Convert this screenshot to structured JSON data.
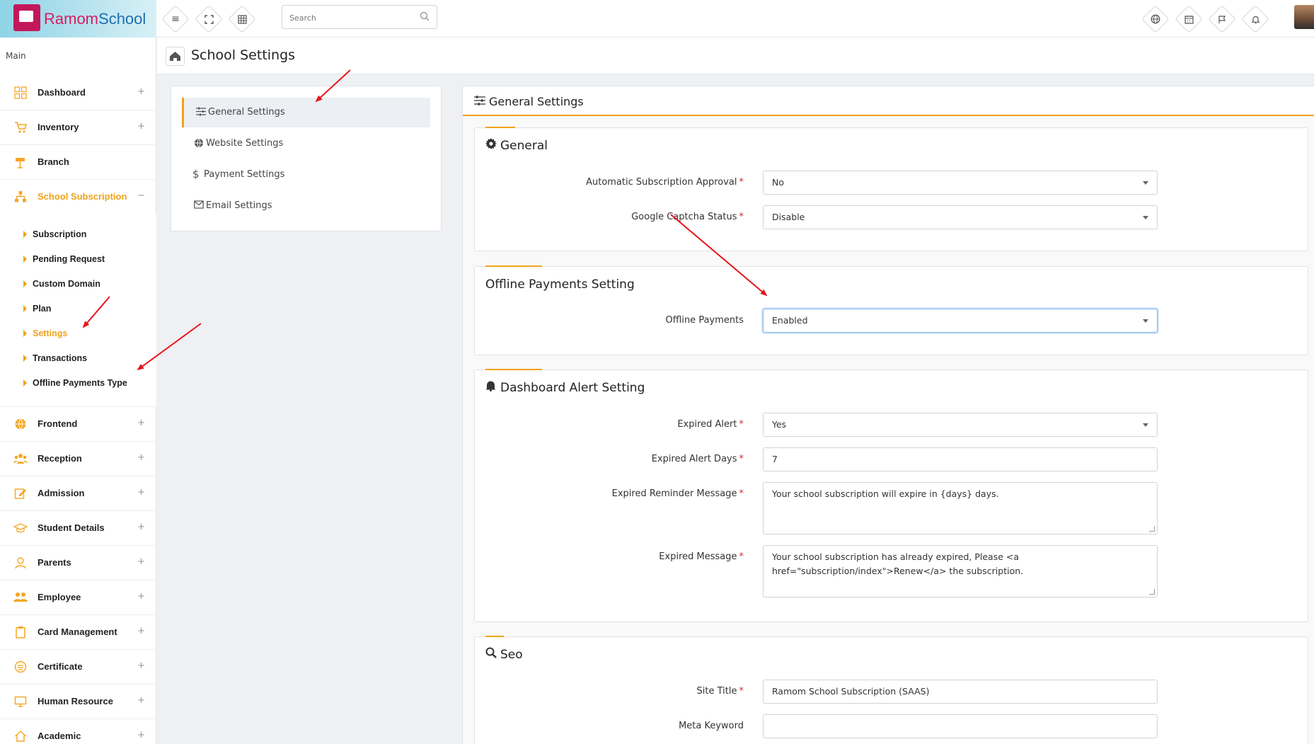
{
  "brand": {
    "part1": "Ramom",
    "part2": "School"
  },
  "topbar": {
    "search_placeholder": "Search",
    "left_tools": [
      "menu-icon",
      "fullscreen-icon",
      "grid-icon"
    ],
    "right_tools": [
      "globe-icon",
      "calendar-icon",
      "flag-icon",
      "bell-icon"
    ]
  },
  "sidebar": {
    "title": "Main",
    "items": [
      {
        "label": "Dashboard",
        "icon": "dashboard-icon",
        "toggle": "+"
      },
      {
        "label": "Inventory",
        "icon": "cart-icon",
        "toggle": "+"
      },
      {
        "label": "Branch",
        "icon": "signpost-icon",
        "toggle": ""
      },
      {
        "label": "School Subscription",
        "icon": "sitemap-icon",
        "toggle": "−"
      }
    ],
    "subscription_sub": [
      {
        "label": "Subscription"
      },
      {
        "label": "Pending Request"
      },
      {
        "label": "Custom Domain"
      },
      {
        "label": "Plan"
      },
      {
        "label": "Settings"
      },
      {
        "label": "Transactions"
      },
      {
        "label": "Offline Payments Type"
      }
    ],
    "items_after": [
      {
        "label": "Frontend",
        "icon": "globe-icon",
        "toggle": "+"
      },
      {
        "label": "Reception",
        "icon": "users-icon",
        "toggle": "+"
      },
      {
        "label": "Admission",
        "icon": "edit-icon",
        "toggle": "+"
      },
      {
        "label": "Student Details",
        "icon": "graduation-icon",
        "toggle": "+"
      },
      {
        "label": "Parents",
        "icon": "user-icon",
        "toggle": "+"
      },
      {
        "label": "Employee",
        "icon": "team-icon",
        "toggle": "+"
      },
      {
        "label": "Card Management",
        "icon": "clipboard-icon",
        "toggle": "+"
      },
      {
        "label": "Certificate",
        "icon": "certificate-icon",
        "toggle": "+"
      },
      {
        "label": "Human Resource",
        "icon": "monitor-icon",
        "toggle": "+"
      },
      {
        "label": "Academic",
        "icon": "home-icon",
        "toggle": "+"
      }
    ]
  },
  "page": {
    "title": "School Settings"
  },
  "settings_menu": [
    {
      "label": "General Settings",
      "icon": "sliders-icon"
    },
    {
      "label": "Website Settings",
      "icon": "globe-icon"
    },
    {
      "label": "Payment Settings",
      "icon": "dollar-icon"
    },
    {
      "label": "Email Settings",
      "icon": "envelope-icon"
    }
  ],
  "panel": {
    "title": "General Settings",
    "general": {
      "title": "General",
      "automatic_approval_label": "Automatic Subscription Approval",
      "automatic_approval_value": "No",
      "captcha_label": "Google Captcha Status",
      "captcha_value": "Disable"
    },
    "offline": {
      "title": "Offline Payments Setting",
      "label": "Offline Payments",
      "value": "Enabled"
    },
    "alert": {
      "title": "Dashboard Alert Setting",
      "expired_alert_label": "Expired Alert",
      "expired_alert_value": "Yes",
      "expired_days_label": "Expired Alert Days",
      "expired_days_value": "7",
      "reminder_label": "Expired Reminder Message",
      "reminder_value": "Your school subscription will expire in {days} days.",
      "expired_msg_label": "Expired Message",
      "expired_msg_value": "Your school subscription has already expired, Please <a href=\"subscription/index\">Renew</a> the subscription."
    },
    "seo": {
      "title": "Seo",
      "site_title_label": "Site Title",
      "site_title_value": "Ramom School Subscription (SAAS)",
      "meta_keyword_label": "Meta Keyword",
      "meta_keyword_value": ""
    },
    "required_mark": "*"
  },
  "colors": {
    "accent": "#f0a21b",
    "required": "#e02424",
    "annotation_arrow": "#e8141b"
  }
}
